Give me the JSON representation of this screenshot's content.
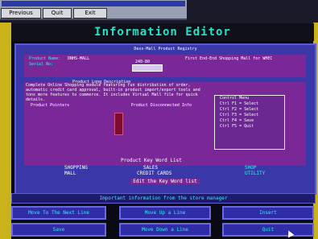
{
  "window": {
    "strip_text": "",
    "buttons": [
      "Previous",
      "Quit",
      "Exit"
    ]
  },
  "header": {
    "title": "Information Editor"
  },
  "screen": {
    "title": "Dess-Mall Product Registry",
    "panel_text": {
      "product_name_label": "Product Name:",
      "product_name_value": "DNHS-MALL",
      "first_label": "First End-End Shopping Mall for WHEC",
      "serial_label": "Serial No:",
      "serial_value": "240-80"
    },
    "mid_title": "Product Long Description",
    "description": "Complete Online Shopping module featuring fun distribution of order, automatic credit card approval, built-in product import/export tools and tons more features to commerce. It includes Virtual Mall file for quick details.",
    "subheaders": [
      "Product Pointers",
      "Product Disconnected Info"
    ],
    "controls": {
      "title": "Control Menu",
      "rows": [
        "Ctrl F1 = Select",
        "Ctrl F2 = Select",
        "Ctrl F3 = Select",
        "Ctrl F4 = Save",
        "Ctrl F5 = Quit"
      ]
    },
    "keywords_title": "Product Key Word List",
    "keywords": [
      "SHOPPING",
      "MALL",
      "SALES",
      "CREDIT CARDS",
      "SHOP",
      "UTILITY"
    ],
    "bottom_hint": "Edit the Key Word list"
  },
  "status": "Important information from the store manager",
  "buttons_row1": [
    "Move To The Next Line",
    "Move Up a Line",
    "Insert"
  ],
  "buttons_row2": [
    "Save",
    "Move Down a Line",
    "Quit"
  ]
}
